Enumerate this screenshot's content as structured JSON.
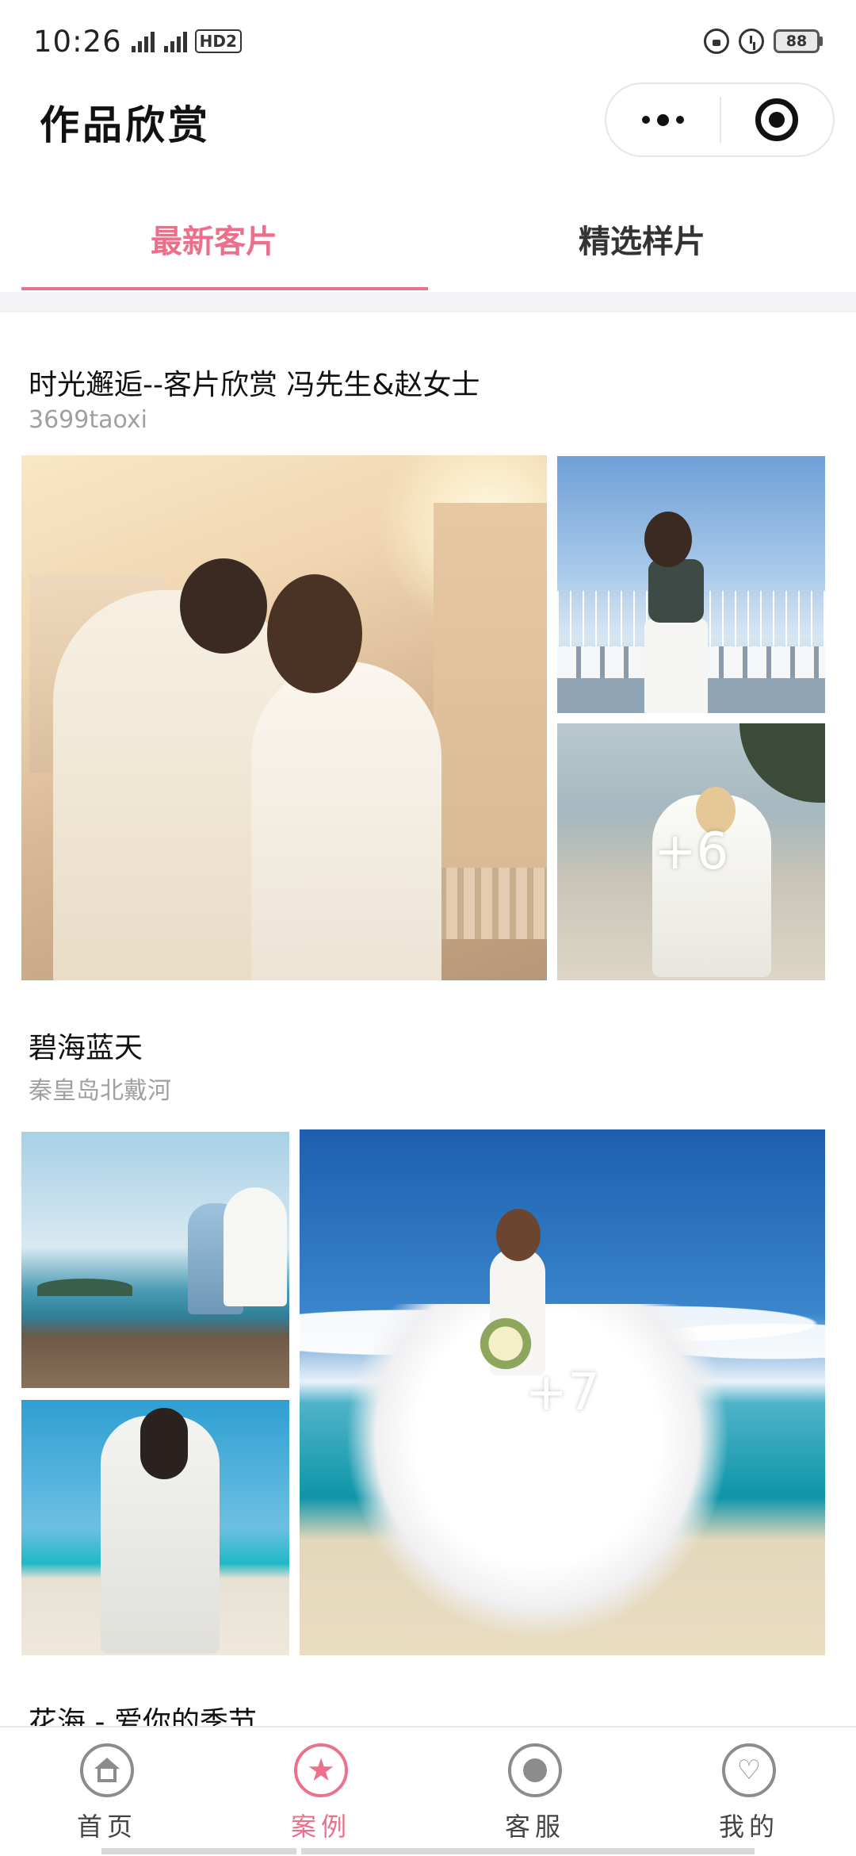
{
  "status_bar": {
    "time": "10:26",
    "network": "2G 4G",
    "hd_label": "HD2",
    "battery": "88"
  },
  "header": {
    "title": "作品欣赏",
    "more_icon": "more-dots-icon",
    "close_icon": "target-circle-icon"
  },
  "tabs": [
    {
      "label": "最新客片",
      "active": true
    },
    {
      "label": "精选样片",
      "active": false
    }
  ],
  "albums": [
    {
      "title": "时光邂逅--客片欣赏 冯先生&赵女士",
      "subtitle": "3699taoxi",
      "more_count": "+6"
    },
    {
      "title": "碧海蓝天",
      "subtitle": "秦皇岛北戴河",
      "more_count": "+7"
    },
    {
      "title": "花海 - 爱你的季节"
    }
  ],
  "tabbar": [
    {
      "label": "首页",
      "icon": "home-icon",
      "active": false
    },
    {
      "label": "案例",
      "icon": "star-icon",
      "active": true
    },
    {
      "label": "客服",
      "icon": "customer-service-icon",
      "active": false
    },
    {
      "label": "我的",
      "icon": "heart-icon",
      "active": false
    }
  ],
  "colors": {
    "accent": "#ec6f8b",
    "text": "#111111",
    "subtext": "#a0a0a0",
    "divider": "#f4f4f6"
  }
}
